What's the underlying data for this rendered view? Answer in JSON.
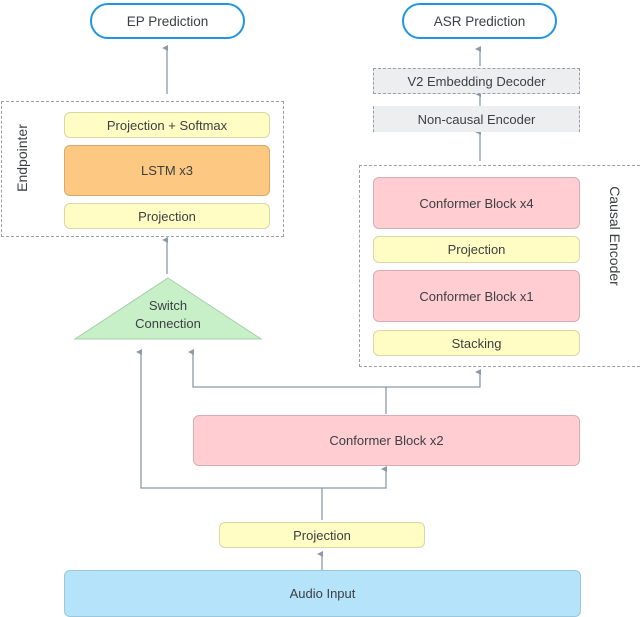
{
  "outputs": {
    "ep_prediction": "EP Prediction",
    "asr_prediction": "ASR Prediction"
  },
  "endpointer": {
    "label": "Endpointer",
    "layers": [
      "Projection + Softmax",
      "LSTM x3",
      "Projection"
    ]
  },
  "asr_decoder": {
    "v2_embedding_decoder": "V2 Embedding Decoder",
    "non_causal_encoder": "Non-causal Encoder"
  },
  "causal_encoder": {
    "label": "Causal Encoder",
    "layers": [
      "Conformer Block x4",
      "Projection",
      "Conformer Block x1",
      "Stacking"
    ]
  },
  "switch_connection": {
    "line1": "Switch",
    "line2": "Connection"
  },
  "shared": {
    "conformer_block": "Conformer Block x2",
    "projection": "Projection",
    "audio_input": "Audio Input"
  },
  "colors": {
    "projection": "#fffdc4",
    "conformer": "#ffcdd2",
    "lstm": "#fcc882",
    "switch": "#c8f0c8",
    "audio": "#b4e3fa",
    "prediction_border": "#2196e0",
    "arrow": "#8a9aa8"
  }
}
